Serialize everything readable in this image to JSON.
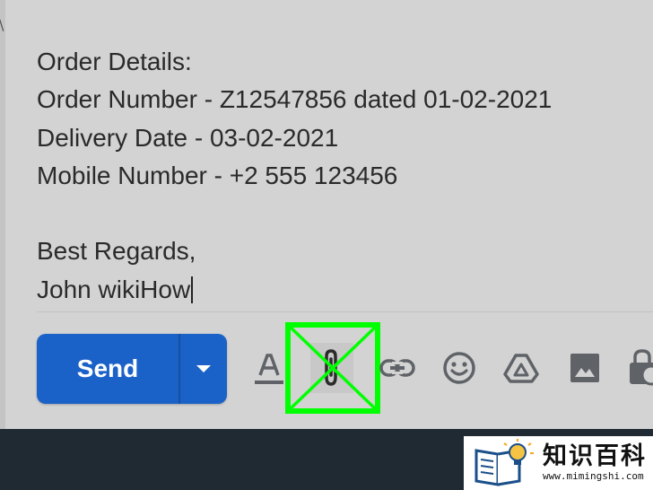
{
  "email": {
    "body_lines": [
      "Order Details:",
      "Order Number - Z12547856 dated 01-02-2021",
      "Delivery Date - 03-02-2021",
      "Mobile Number - +2 555 123456",
      "",
      "Best Regards,",
      "John wikiHow"
    ]
  },
  "toolbar": {
    "send_label": "Send",
    "icons": [
      "formatting-icon",
      "paperclip-icon",
      "link-icon",
      "emoji-icon",
      "drive-icon",
      "photo-icon",
      "lock-clock-icon"
    ]
  },
  "highlight": {
    "target": "attach-files-button",
    "color": "#00ff00"
  },
  "colors": {
    "compose_bg": "#d3d3d3",
    "send_bg": "#1b62c8",
    "icon": "#5f6368",
    "bottom_bar": "#1f2a33"
  },
  "watermark": {
    "name": "知识百科",
    "url": "www.mimingshi.com"
  }
}
